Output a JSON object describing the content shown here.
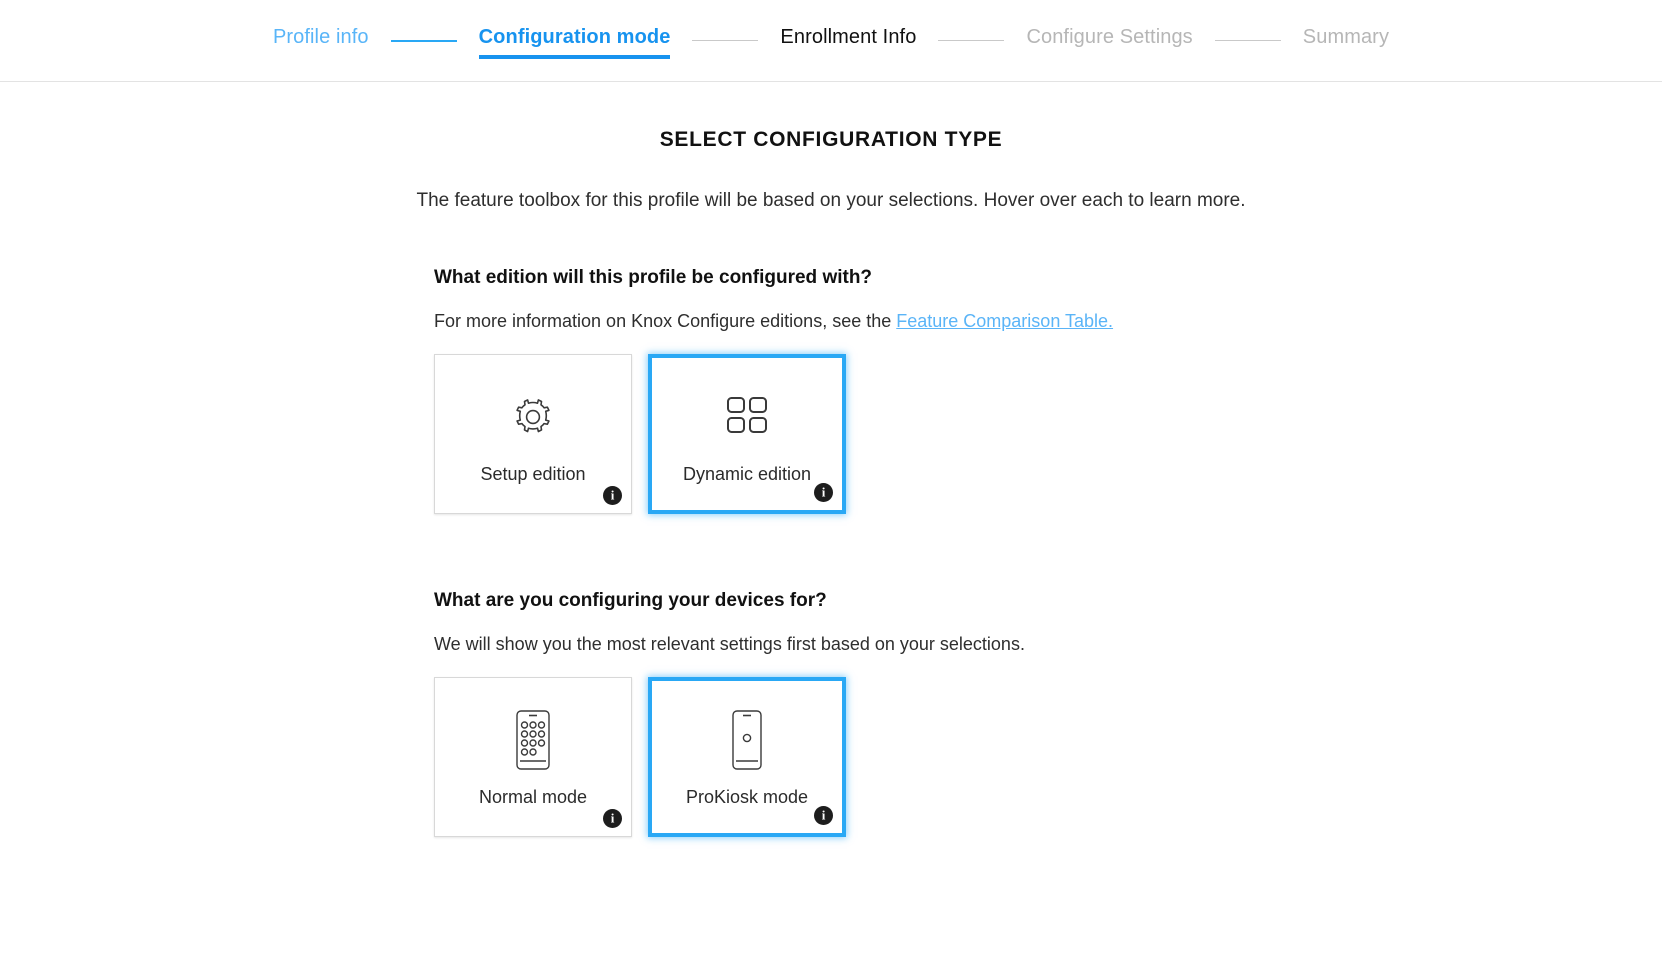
{
  "stepper": {
    "steps": [
      {
        "label": "Profile info",
        "state": "done"
      },
      {
        "label": "Configuration mode",
        "state": "current"
      },
      {
        "label": "Enrollment Info",
        "state": "next"
      },
      {
        "label": "Configure Settings",
        "state": "upcoming"
      },
      {
        "label": "Summary",
        "state": "upcoming"
      }
    ]
  },
  "page": {
    "title": "SELECT CONFIGURATION TYPE",
    "description": "The feature toolbox for this profile will be based on your selections. Hover over each to learn more."
  },
  "edition_section": {
    "question": "What edition will this profile be configured with?",
    "sub_prefix": "For more information on Knox Configure editions, see the ",
    "link_text": "Feature Comparison Table.",
    "cards": [
      {
        "label": "Setup edition",
        "icon": "gear-icon",
        "selected": false,
        "info": "i"
      },
      {
        "label": "Dynamic edition",
        "icon": "grid-squares-icon",
        "selected": true,
        "info": "i"
      }
    ]
  },
  "mode_section": {
    "question": "What are you configuring your devices for?",
    "sub": "We will show you the most relevant settings first based on your selections.",
    "cards": [
      {
        "label": "Normal mode",
        "icon": "phone-apps-icon",
        "selected": false,
        "info": "i"
      },
      {
        "label": "ProKiosk mode",
        "icon": "phone-kiosk-icon",
        "selected": true,
        "info": "i"
      }
    ]
  },
  "colors": {
    "accent": "#29a8f5",
    "done_step": "#59b5f8",
    "link": "#5ab4f7",
    "badge": "#1d1d1d"
  }
}
